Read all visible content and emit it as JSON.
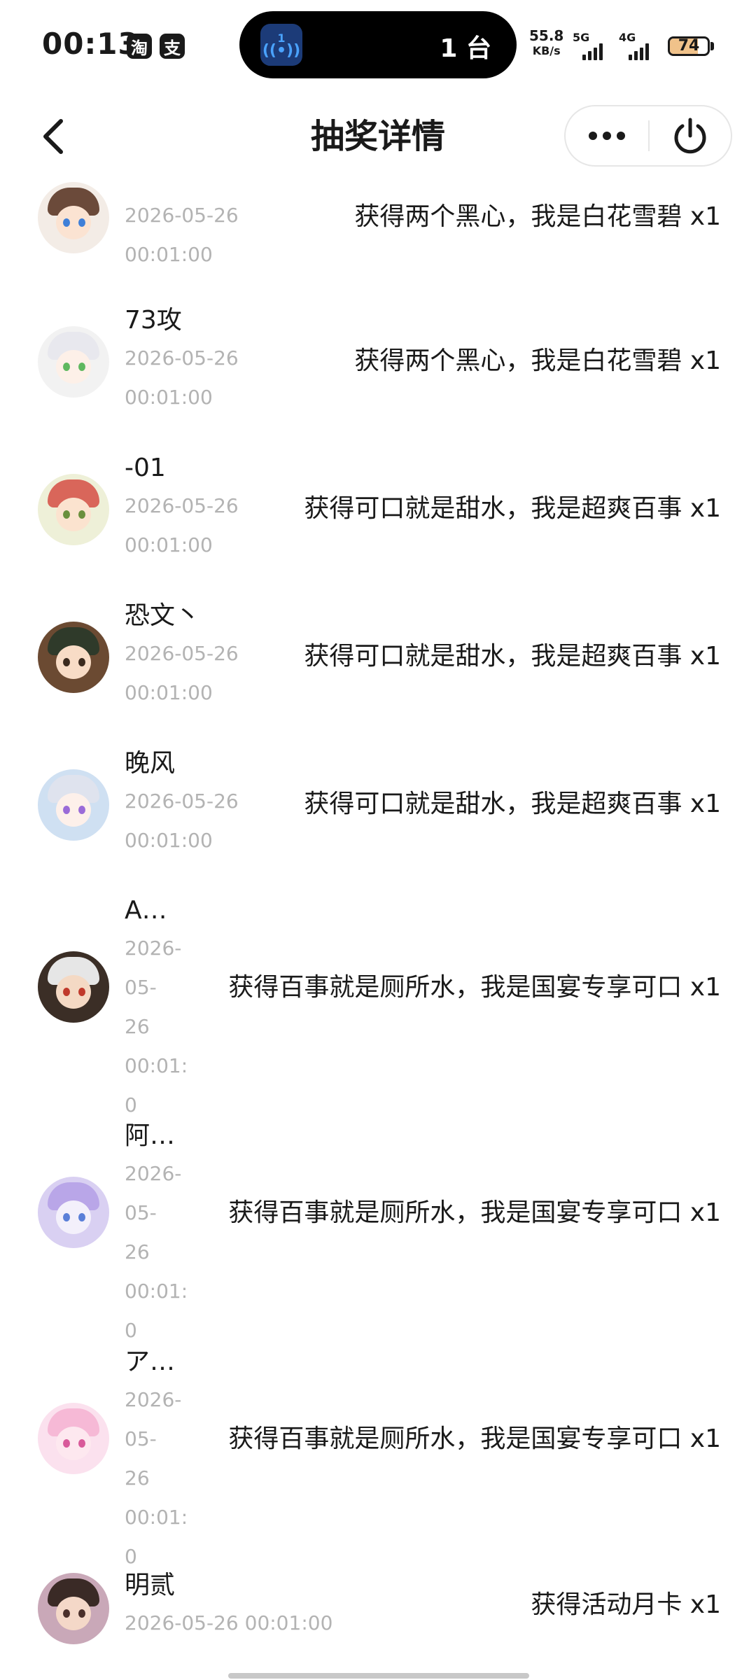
{
  "status_bar": {
    "time": "00:13",
    "app_badges": [
      "淘",
      "支"
    ],
    "island_count": "1 台",
    "island_badge": "1",
    "net_speed_value": "55.8",
    "net_speed_unit": "KB/s",
    "signal_1": "5G",
    "signal_2": "4G",
    "battery": "74",
    "battery_level_percent": 74
  },
  "nav": {
    "title": "抽奖详情"
  },
  "records": [
    {
      "name": "",
      "time": "2026-05-26\n00:01:00",
      "prize": "获得两个黑心，我是白花雪碧 x1",
      "avatar_colors": {
        "hair": "#6b4a3a",
        "skin": "#fbe3d2",
        "eye": "#3f7fd8",
        "bg": "#f3ece6"
      }
    },
    {
      "name": "73攻",
      "time": "2026-05-26\n00:01:00",
      "prize": "获得两个黑心，我是白花雪碧 x1",
      "avatar_colors": {
        "hair": "#e8e8ee",
        "skin": "#fdf0e8",
        "eye": "#5fb85f",
        "bg": "#f2f2f2"
      }
    },
    {
      "name": "-01",
      "time": "2026-05-26\n00:01:00",
      "prize": "获得可口就是甜水，我是超爽百事 x1",
      "avatar_colors": {
        "hair": "#d9665a",
        "skin": "#fbe3cf",
        "eye": "#6a8f3c",
        "bg": "#eef0d8"
      }
    },
    {
      "name": "恐文丶",
      "time": "2026-05-26\n00:01:00",
      "prize": "获得可口就是甜水，我是超爽百事 x1",
      "avatar_colors": {
        "hair": "#2f3a2a",
        "skin": "#f8dcc6",
        "eye": "#3b2a1e",
        "bg": "#6b4a32"
      }
    },
    {
      "name": "晚风",
      "time": "2026-05-26\n00:01:00",
      "prize": "获得可口就是甜水，我是超爽百事 x1",
      "avatar_colors": {
        "hair": "#dfe3ee",
        "skin": "#fdf0ea",
        "eye": "#9a6bd8",
        "bg": "#cfe0f2"
      }
    },
    {
      "name": "A…",
      "time": "2026-\n05-\n26\n00:01:0",
      "prize": "获得百事就是厕所水，我是国宴专享可口 x1",
      "avatar_colors": {
        "hair": "#e6e6e6",
        "skin": "#f4d9c4",
        "eye": "#c0392b",
        "bg": "#3b2e26"
      }
    },
    {
      "name": "阿…",
      "time": "2026-\n05-\n26\n00:01:0",
      "prize": "获得百事就是厕所水，我是国宴专享可口 x1",
      "avatar_colors": {
        "hair": "#b9a6e8",
        "skin": "#f3f0fb",
        "eye": "#5a7fd8",
        "bg": "#d9d0f2"
      }
    },
    {
      "name": "ア…",
      "time": "2026-\n05-\n26\n00:01:0",
      "prize": "获得百事就是厕所水，我是国宴专享可口 x1",
      "avatar_colors": {
        "hair": "#f6b9d6",
        "skin": "#fde8ef",
        "eye": "#d85a9a",
        "bg": "#fbe1ee"
      }
    },
    {
      "name": "明贰",
      "time": "2026-05-26 00:01:00",
      "prize": "获得活动月卡 x1",
      "avatar_colors": {
        "hair": "#3a2a26",
        "skin": "#f4d8c8",
        "eye": "#4a2f2a",
        "bg": "#c9a8b8"
      }
    }
  ]
}
